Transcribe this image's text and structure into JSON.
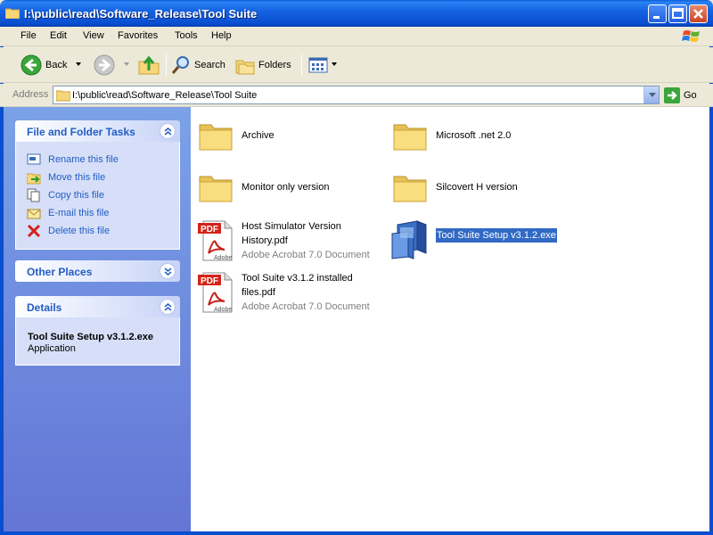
{
  "window": {
    "title": "I:\\public\\read\\Software_Release\\Tool Suite"
  },
  "menu": {
    "items": [
      "File",
      "Edit",
      "View",
      "Favorites",
      "Tools",
      "Help"
    ]
  },
  "toolbar": {
    "back_label": "Back",
    "search_label": "Search",
    "folders_label": "Folders"
  },
  "address": {
    "label": "Address",
    "value": "I:\\public\\read\\Software_Release\\Tool Suite",
    "go_label": "Go"
  },
  "tasks_panel": {
    "title": "File and Folder Tasks",
    "items": [
      {
        "label": "Rename this file",
        "icon": "rename-icon"
      },
      {
        "label": "Move this file",
        "icon": "move-icon"
      },
      {
        "label": "Copy this file",
        "icon": "copy-icon"
      },
      {
        "label": "E-mail this file",
        "icon": "email-icon"
      },
      {
        "label": "Delete this file",
        "icon": "delete-icon"
      }
    ]
  },
  "other_places_panel": {
    "title": "Other Places"
  },
  "details_panel": {
    "title": "Details",
    "name": "Tool Suite Setup v3.1.2.exe",
    "type": "Application"
  },
  "files": {
    "archive": {
      "name": "Archive"
    },
    "dotnet": {
      "name": "Microsoft .net 2.0"
    },
    "monitor": {
      "name": "Monitor only version"
    },
    "silcovert": {
      "name": "Silcovert H version"
    },
    "host_pdf": {
      "name_line1": "Host Simulator Version",
      "name_line2": "History.pdf",
      "type": "Adobe Acrobat 7.0 Document"
    },
    "setup_exe": {
      "name": "Tool Suite Setup v3.1.2.exe"
    },
    "installed_pdf": {
      "name_line1": "Tool Suite v3.1.2 installed",
      "name_line2": "files.pdf",
      "type": "Adobe Acrobat 7.0 Document"
    }
  },
  "pdf_icon": {
    "badge": "PDF",
    "brand": "Adobe"
  },
  "colors": {
    "titlebar": "#0a4fd0",
    "link": "#215dc6",
    "selection": "#316ac5",
    "taskpane_top": "#7ba2e7",
    "taskpane_bottom": "#6375d6"
  }
}
